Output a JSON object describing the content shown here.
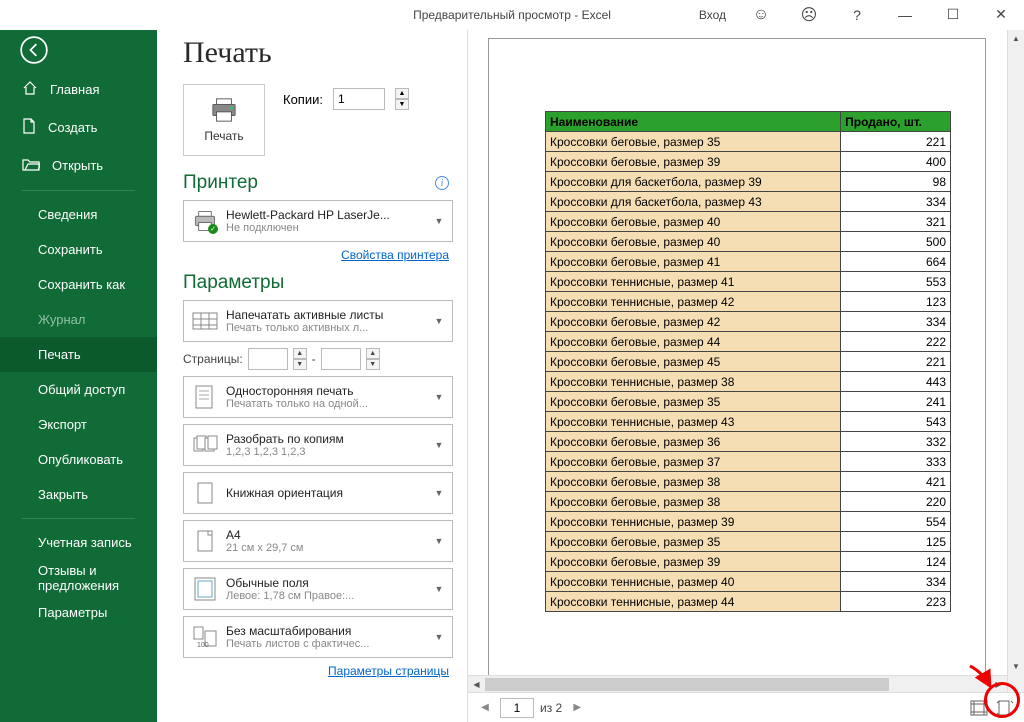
{
  "titlebar": {
    "title": "Предварительный просмотр  -  Excel",
    "login": "Вход"
  },
  "sidebar": {
    "top": [
      {
        "label": "Главная",
        "icon": "home"
      },
      {
        "label": "Создать",
        "icon": "new"
      },
      {
        "label": "Открыть",
        "icon": "open"
      }
    ],
    "mid": [
      {
        "label": "Сведения"
      },
      {
        "label": "Сохранить"
      },
      {
        "label": "Сохранить как"
      },
      {
        "label": "Журнал",
        "dim": true
      },
      {
        "label": "Печать",
        "active": true
      },
      {
        "label": "Общий доступ"
      },
      {
        "label": "Экспорт"
      },
      {
        "label": "Опубликовать"
      },
      {
        "label": "Закрыть"
      }
    ],
    "bottom": [
      {
        "label": "Учетная запись"
      },
      {
        "label": "Отзывы и предложения"
      },
      {
        "label": "Параметры"
      }
    ]
  },
  "page": {
    "title": "Печать"
  },
  "print": {
    "buttonLabel": "Печать",
    "copiesLabel": "Копии:",
    "copiesValue": "1"
  },
  "printer": {
    "heading": "Принтер",
    "name": "Hewlett-Packard HP LaserJe...",
    "status": "Не подключен",
    "propsLink": "Свойства принтера"
  },
  "params": {
    "heading": "Параметры",
    "activeSheets": {
      "t1": "Напечатать активные листы",
      "t2": "Печать только активных л..."
    },
    "pagesLabel": "Страницы:",
    "pagesSep": "-",
    "oneSide": {
      "t1": "Односторонняя печать",
      "t2": "Печатать только на одной..."
    },
    "collate": {
      "t1": "Разобрать по копиям",
      "t2": "1,2,3   1,2,3   1,2,3"
    },
    "orient": {
      "t1": "Книжная ориентация",
      "t2": ""
    },
    "paper": {
      "t1": "A4",
      "t2": "21 см x 29,7 см"
    },
    "margins": {
      "t1": "Обычные поля",
      "t2": "Левое:  1,78 см    Правое:..."
    },
    "scale": {
      "t1": "Без масштабирования",
      "t2": "Печать листов с фактичес..."
    },
    "pageSetupLink": "Параметры страницы"
  },
  "preview": {
    "currentPage": "1",
    "totalLabel": "из 2",
    "columns": [
      "Наименование",
      "Продано, шт."
    ],
    "rows": [
      [
        "Кроссовки беговые, размер 35",
        "221"
      ],
      [
        "Кроссовки беговые, размер 39",
        "400"
      ],
      [
        "Кроссовки для баскетбола, размер 39",
        "98"
      ],
      [
        "Кроссовки для баскетбола, размер 43",
        "334"
      ],
      [
        "Кроссовки беговые, размер 40",
        "321"
      ],
      [
        "Кроссовки беговые, размер 40",
        "500"
      ],
      [
        "Кроссовки беговые, размер 41",
        "664"
      ],
      [
        "Кроссовки теннисные, размер 41",
        "553"
      ],
      [
        "Кроссовки теннисные, размер 42",
        "123"
      ],
      [
        "Кроссовки беговые, размер 42",
        "334"
      ],
      [
        "Кроссовки беговые, размер 44",
        "222"
      ],
      [
        "Кроссовки беговые, размер 45",
        "221"
      ],
      [
        "Кроссовки теннисные, размер 38",
        "443"
      ],
      [
        "Кроссовки беговые, размер 35",
        "241"
      ],
      [
        "Кроссовки теннисные, размер 43",
        "543"
      ],
      [
        "Кроссовки беговые, размер 36",
        "332"
      ],
      [
        "Кроссовки беговые, размер 37",
        "333"
      ],
      [
        "Кроссовки беговые, размер 38",
        "421"
      ],
      [
        "Кроссовки беговые, размер 38",
        "220"
      ],
      [
        "Кроссовки теннисные, размер 39",
        "554"
      ],
      [
        "Кроссовки беговые, размер 35",
        "125"
      ],
      [
        "Кроссовки беговые, размер 39",
        "124"
      ],
      [
        "Кроссовки теннисные, размер 40",
        "334"
      ],
      [
        "Кроссовки теннисные, размер 44",
        "223"
      ]
    ]
  }
}
